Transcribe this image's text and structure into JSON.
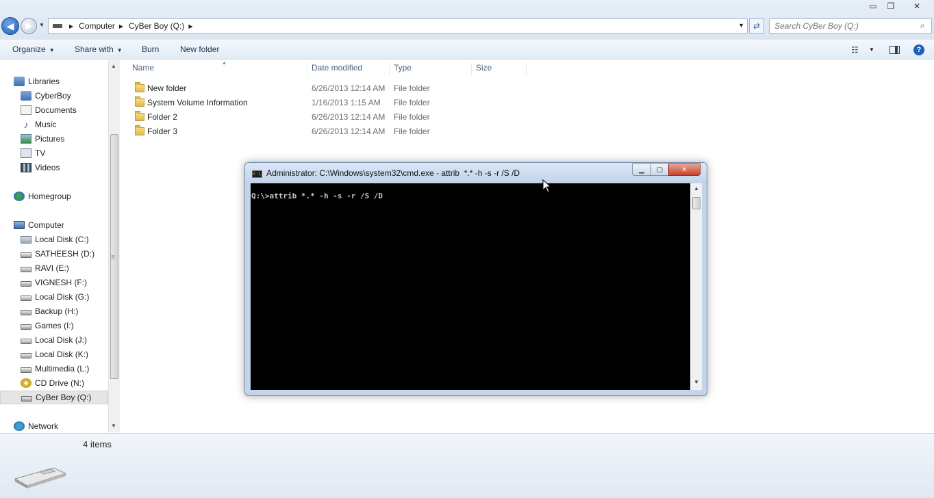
{
  "window": {
    "min_glyph": "▭",
    "max_glyph": "❐",
    "close_glyph": "✕"
  },
  "address": {
    "crumbs": [
      "Computer",
      "CyBer Boy (Q:)"
    ],
    "search_placeholder": "Search CyBer Boy (Q:)"
  },
  "toolbar": {
    "organize": "Organize",
    "share_with": "Share with",
    "burn": "Burn",
    "new_folder": "New folder"
  },
  "nav": {
    "libraries": "Libraries",
    "library_items": [
      "CyberBoy",
      "Documents",
      "Music",
      "Pictures",
      "TV",
      "Videos"
    ],
    "homegroup": "Homegroup",
    "computer": "Computer",
    "drives": [
      "Local Disk (C:)",
      "SATHEESH (D:)",
      "RAVI (E:)",
      "VIGNESH (F:)",
      "Local Disk (G:)",
      "Backup (H:)",
      "Games (I:)",
      "Local Disk (J:)",
      "Local Disk (K:)",
      "Multimedia (L:)",
      "CD Drive (N:)",
      "CyBer Boy (Q:)"
    ],
    "network": "Network",
    "selected_drive": "CyBer Boy (Q:)"
  },
  "filelist": {
    "columns": [
      "Name",
      "Date modified",
      "Type",
      "Size"
    ],
    "rows": [
      {
        "name": "New folder",
        "date": "6/26/2013 12:14 AM",
        "type": "File folder"
      },
      {
        "name": "System Volume Information",
        "date": "1/16/2013 1:15 AM",
        "type": "File folder"
      },
      {
        "name": "Folder 2",
        "date": "6/26/2013 12:14 AM",
        "type": "File folder"
      },
      {
        "name": "Folder 3",
        "date": "6/26/2013 12:14 AM",
        "type": "File folder"
      }
    ]
  },
  "details": {
    "item_count": "4 items"
  },
  "cmd": {
    "title": "Administrator: C:\\Windows\\system32\\cmd.exe - attrib  *.* -h -s -r /S /D",
    "icon_text": "C:\\",
    "command_line": "Q:\\>attrib *.* -h -s -r /S /D"
  },
  "colors": {
    "accent": "#1d5fb8",
    "console_bg": "#000000",
    "close_red": "#c7432b"
  }
}
